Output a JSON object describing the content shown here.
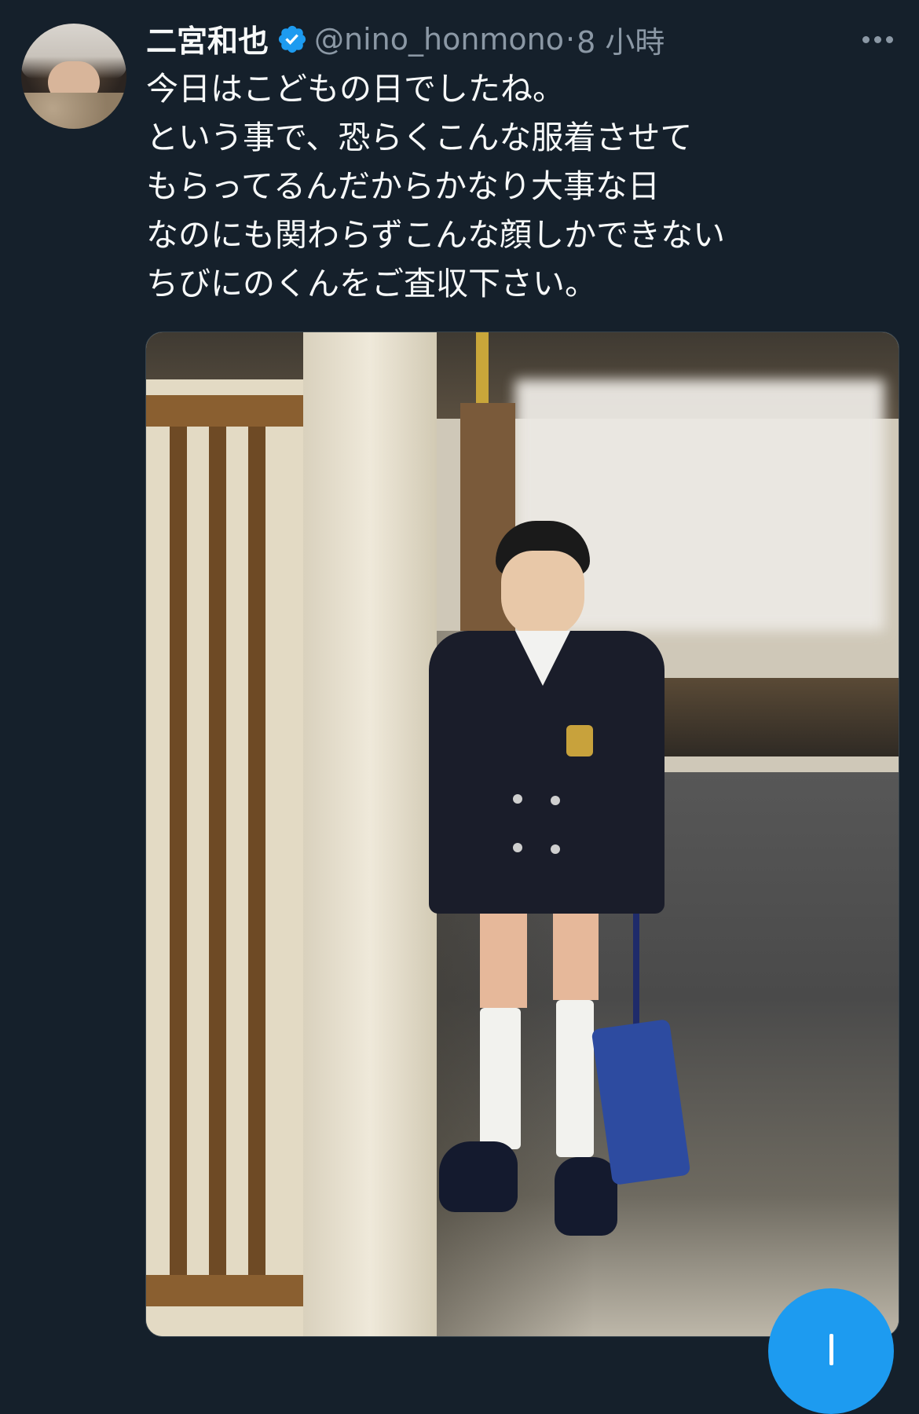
{
  "tweet": {
    "author_name": "二宮和也",
    "handle": "@nino_honmono",
    "separator": "·",
    "time": "8 小時",
    "verified_icon": "verified-badge-icon",
    "more_icon": "more-options-icon",
    "text_lines": [
      "今日はこどもの日でしたね。",
      "という事で、恐らくこんな服着させて",
      "もらってるんだからかなり大事な日",
      "なのにも関わらずこんな顔しかできない",
      "ちびにのくんをご査収下さい。"
    ]
  },
  "media": {
    "type": "photo"
  },
  "compose_button": {
    "icon": "compose-plus-icon",
    "color": "#1d9bf0"
  },
  "colors": {
    "background": "#15202b",
    "text": "#f7f9f9",
    "secondary_text": "#8b98a5",
    "verified": "#1d9bf0"
  }
}
